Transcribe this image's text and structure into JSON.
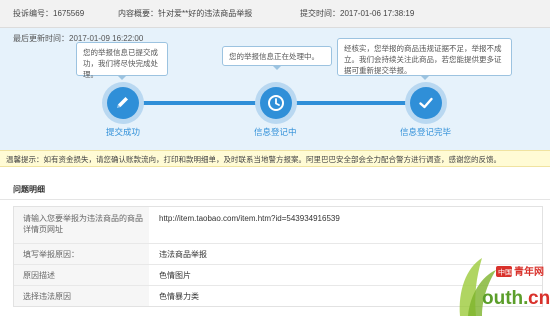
{
  "header": {
    "complaint_no": "投诉编号：1675569",
    "content_summary": "内容概要：针对爱**好的违法商品举报",
    "submit_time": "提交时间：2017-01-06 17:38:19"
  },
  "last_updated": "最后更新时间：2017-01-09 16:22:00",
  "bubbles": [
    "您的举报信息已提交成功，我们将尽快完成处理。",
    "您的举报信息正在处理中。",
    "经核实，您举报的商品违规证据不足，举报不成立。我们会持续关注此商品，若您能提供更多证据可重新提交举报。"
  ],
  "steps": [
    "提交成功",
    "信息登记中",
    "信息登记完毕"
  ],
  "warning": "温馨提示：如有资金损失，请您确认账款流向，打印和款明细单，及时联系当地警方报案。阿里巴巴安全部会全力配合警方进行调查，感谢您的反馈。",
  "question_title": "问题明细",
  "rows": [
    {
      "label": "请输入您要举报为违法商品的商品详情页网址",
      "value": "http://item.taobao.com/item.htm?id=543934916539"
    },
    {
      "label": "填写举报原因：",
      "value": "违法商品举报"
    },
    {
      "label": "原因描述",
      "value": "色情图片"
    },
    {
      "label": "选择违法原因",
      "value": "色情暴力类"
    }
  ],
  "watermark": {
    "top": "中国青年网",
    "bottom": "youth.cn"
  },
  "colors": {
    "accent": "#2f8fd8",
    "warning_bg": "#fffbd5"
  }
}
